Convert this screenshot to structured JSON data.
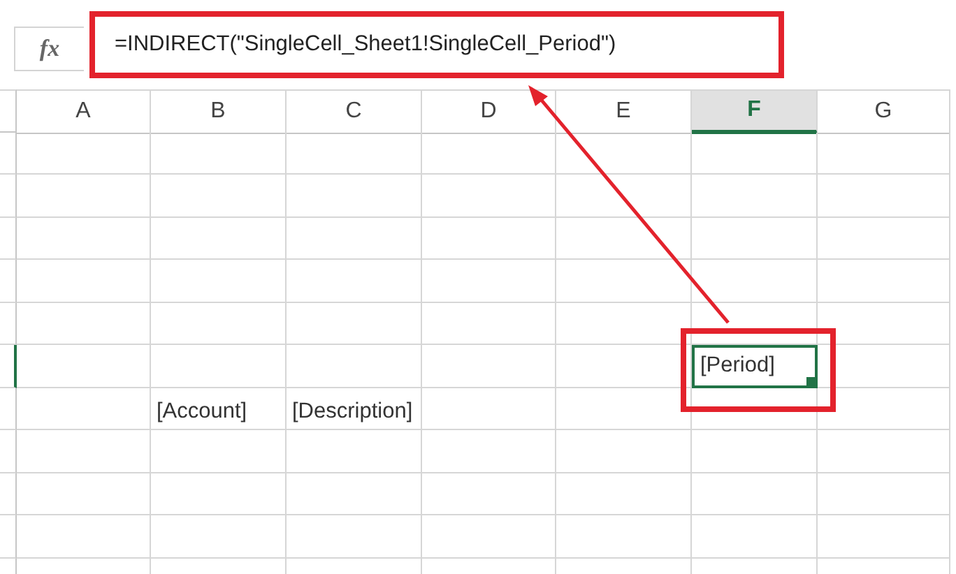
{
  "formula_bar": {
    "function_label": "fx",
    "formula": "=INDIRECT(\"SingleCell_Sheet1!SingleCell_Period\")"
  },
  "columns": [
    {
      "label": "A",
      "selected": false
    },
    {
      "label": "B",
      "selected": false
    },
    {
      "label": "C",
      "selected": false
    },
    {
      "label": "D",
      "selected": false
    },
    {
      "label": "E",
      "selected": false
    },
    {
      "label": "F",
      "selected": true
    },
    {
      "label": "G",
      "selected": false
    }
  ],
  "rows": [
    {
      "selected": false,
      "cells": [
        null,
        null,
        null,
        null,
        null,
        null,
        null
      ]
    },
    {
      "selected": false,
      "cells": [
        null,
        null,
        null,
        null,
        null,
        null,
        null
      ]
    },
    {
      "selected": false,
      "cells": [
        null,
        null,
        null,
        null,
        null,
        null,
        null
      ]
    },
    {
      "selected": false,
      "cells": [
        null,
        null,
        null,
        null,
        null,
        null,
        null
      ]
    },
    {
      "selected": false,
      "cells": [
        null,
        null,
        null,
        null,
        null,
        null,
        null
      ]
    },
    {
      "selected": true,
      "cells": [
        null,
        null,
        null,
        null,
        null,
        {
          "text": "[Period]",
          "active": true
        },
        null
      ]
    },
    {
      "selected": false,
      "cells": [
        null,
        {
          "text": "[Account]",
          "active": false
        },
        {
          "text": "[Description]",
          "active": false
        },
        null,
        null,
        null,
        null
      ]
    },
    {
      "selected": false,
      "cells": [
        null,
        null,
        null,
        null,
        null,
        null,
        null
      ]
    },
    {
      "selected": false,
      "cells": [
        null,
        null,
        null,
        null,
        null,
        null,
        null
      ]
    },
    {
      "selected": false,
      "cells": [
        null,
        null,
        null,
        null,
        null,
        null,
        null
      ]
    },
    {
      "selected": false,
      "cells": [
        null,
        null,
        null,
        null,
        null,
        null,
        null
      ]
    }
  ]
}
